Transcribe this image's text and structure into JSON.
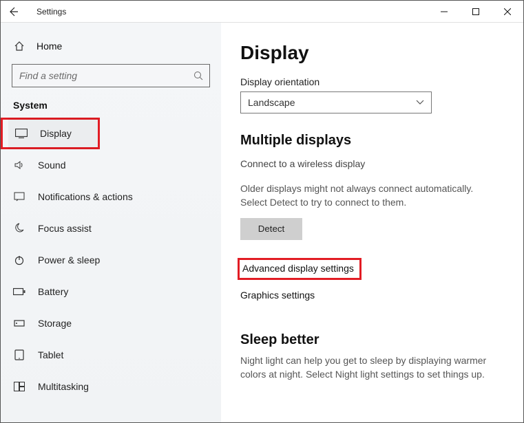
{
  "titlebar": {
    "title": "Settings"
  },
  "sidebar": {
    "home_label": "Home",
    "search_placeholder": "Find a setting",
    "group_title": "System",
    "items": [
      {
        "label": "Display"
      },
      {
        "label": "Sound"
      },
      {
        "label": "Notifications & actions"
      },
      {
        "label": "Focus assist"
      },
      {
        "label": "Power & sleep"
      },
      {
        "label": "Battery"
      },
      {
        "label": "Storage"
      },
      {
        "label": "Tablet"
      },
      {
        "label": "Multitasking"
      }
    ]
  },
  "content": {
    "page_title": "Display",
    "orientation_label": "Display orientation",
    "orientation_value": "Landscape",
    "multiple_displays_heading": "Multiple displays",
    "wireless_link": "Connect to a wireless display",
    "detect_help": "Older displays might not always connect automatically. Select Detect to try to connect to them.",
    "detect_button": "Detect",
    "advanced_link": "Advanced display settings",
    "graphics_link": "Graphics settings",
    "sleep_heading": "Sleep better",
    "sleep_help": "Night light can help you get to sleep by displaying warmer colors at night. Select Night light settings to set things up."
  }
}
